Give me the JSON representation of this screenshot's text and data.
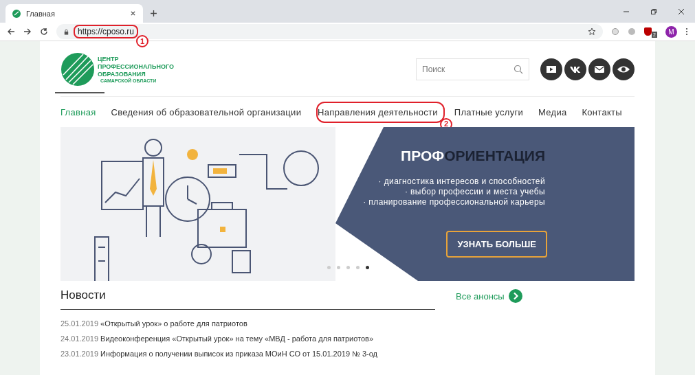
{
  "browser": {
    "tab_title": "Главная",
    "url": "https://cposo.ru",
    "url_circled": true,
    "url_annotation": "1",
    "profile_initial": "M",
    "extension_badge": "2"
  },
  "logo": {
    "lines": [
      "ЦЕНТР",
      "ПРОФЕССИОНАЛЬНОГО",
      "ОБРАЗОВАНИЯ"
    ],
    "subtitle": "САМАРСКОЙ ОБЛАСТИ"
  },
  "search": {
    "placeholder": "Поиск"
  },
  "social": [
    {
      "kind": "youtube"
    },
    {
      "kind": "vk"
    },
    {
      "kind": "mail"
    },
    {
      "kind": "eye"
    }
  ],
  "nav": [
    {
      "label": "Главная",
      "selected": true,
      "circled": false
    },
    {
      "label": "Сведения об образовательной организации",
      "selected": false,
      "circled": false
    },
    {
      "label": "Направления деятельности",
      "selected": false,
      "circled": true,
      "annotation": "2"
    },
    {
      "label": "Платные услуги",
      "selected": false,
      "circled": false
    },
    {
      "label": "Медиа",
      "selected": false,
      "circled": false
    },
    {
      "label": "Контакты",
      "selected": false,
      "circled": false
    }
  ],
  "banner": {
    "title_light": "ПРОФ",
    "title_dark": "ОРИЕНТАЦИЯ",
    "bullets": [
      "· диагностика интересов и способностей",
      "· выбор профессии и места учебы",
      "· планирование профессиональной карьеры"
    ],
    "button": "УЗНАТЬ БОЛЬШЕ",
    "dots": [
      {
        "selected": false
      },
      {
        "selected": false
      },
      {
        "selected": false
      },
      {
        "selected": false
      },
      {
        "selected": true
      }
    ]
  },
  "news": {
    "title": "Новости",
    "all_link": "Все анонсы",
    "items": [
      {
        "date": "25.01.2019",
        "text": "«Открытый урок» о работе для патриотов"
      },
      {
        "date": "24.01.2019",
        "text": "Видеоконференция «Открытый урок» на тему «МВД - работа для патриотов»"
      },
      {
        "date": "23.01.2019",
        "text": "Информация о получении выписок из приказа МОиН СО от 15.01.2019 № 3-од"
      }
    ]
  }
}
